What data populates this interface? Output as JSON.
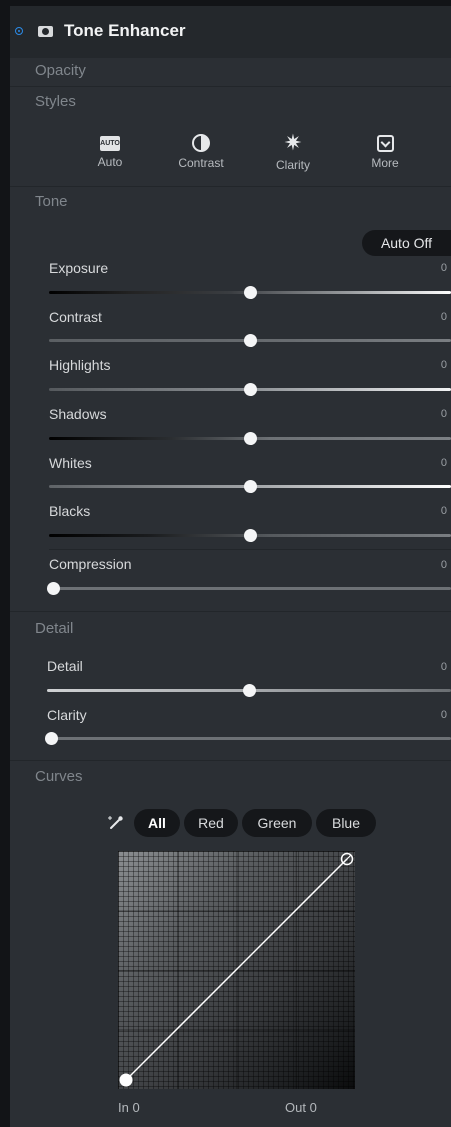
{
  "panel": {
    "title": "Tone Enhancer",
    "accent_color": "#2b8be8",
    "visibility_icon": "radio-dot-icon",
    "mask_icon": "mask-icon"
  },
  "sections": {
    "opacity": "Opacity",
    "styles": "Styles",
    "tone": "Tone",
    "detail": "Detail",
    "curves": "Curves"
  },
  "styles": [
    {
      "label": "Auto",
      "icon": "auto-icon",
      "icon_text": "AUTO"
    },
    {
      "label": "Contrast",
      "icon": "contrast-icon"
    },
    {
      "label": "Clarity",
      "icon": "clarity-icon",
      "glyph": "✷"
    },
    {
      "label": "More",
      "icon": "more-chevron-icon"
    }
  ],
  "tone": {
    "auto_button": "Auto Off",
    "sliders": [
      {
        "label": "Exposure",
        "value": "0",
        "fraction": 0.5
      },
      {
        "label": "Contrast",
        "value": "0",
        "fraction": 0.5
      },
      {
        "label": "Highlights",
        "value": "0",
        "fraction": 0.5
      },
      {
        "label": "Shadows",
        "value": "0",
        "fraction": 0.5
      },
      {
        "label": "Whites",
        "value": "0",
        "fraction": 0.5
      },
      {
        "label": "Blacks",
        "value": "0",
        "fraction": 0.5
      },
      {
        "label": "Compression",
        "value": "0",
        "fraction": 0.0
      }
    ]
  },
  "detail": {
    "sliders": [
      {
        "label": "Detail",
        "value": "0",
        "fraction": 0.5
      },
      {
        "label": "Clarity",
        "value": "0",
        "fraction": 0.0
      }
    ]
  },
  "curves": {
    "picker_icon": "eyedropper-icon",
    "channels": [
      "All",
      "Red",
      "Green",
      "Blue"
    ],
    "active_channel": "All",
    "in_label": "In 0",
    "out_label": "Out 0"
  }
}
